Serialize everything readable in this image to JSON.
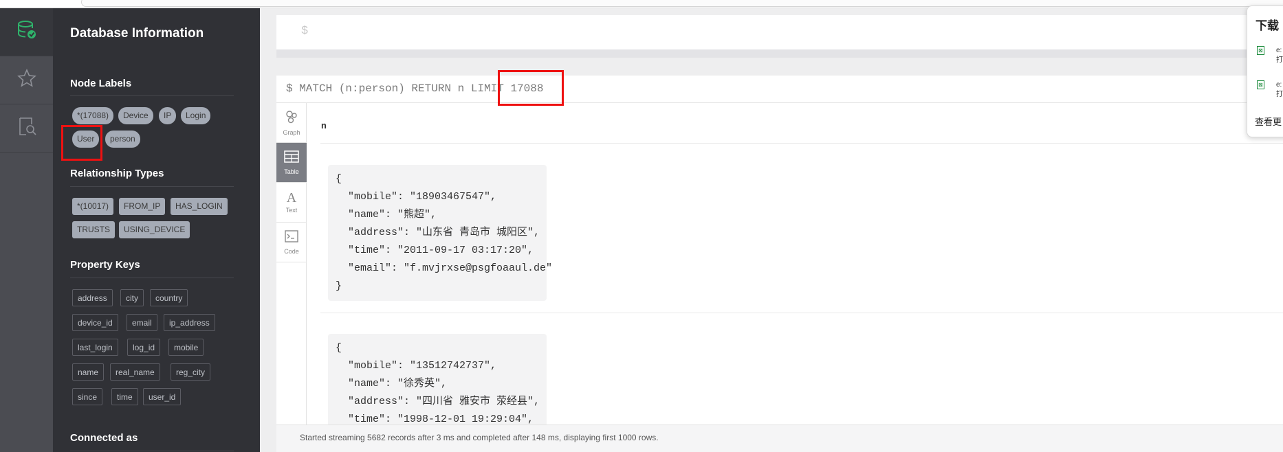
{
  "sidebar": {
    "title": "Database Information",
    "node_labels": {
      "title": "Node Labels",
      "items": [
        "*(17088)",
        "Device",
        "IP",
        "Login",
        "User",
        "person"
      ]
    },
    "relationship_types": {
      "title": "Relationship Types",
      "items": [
        "*(10017)",
        "FROM_IP",
        "HAS_LOGIN",
        "TRUSTS",
        "USING_DEVICE"
      ]
    },
    "property_keys": {
      "title": "Property Keys",
      "items": [
        "address",
        "city",
        "country",
        "device_id",
        "email",
        "ip_address",
        "last_login",
        "log_id",
        "mobile",
        "name",
        "real_name",
        "reg_city",
        "since",
        "time",
        "user_id"
      ]
    },
    "connected_as": "Connected as"
  },
  "rail": {
    "icons": [
      "database-icon",
      "star-icon",
      "search-docs-icon"
    ]
  },
  "editor": {
    "prompt": "$"
  },
  "frame": {
    "query": "$ MATCH (n:person) RETURN n LIMIT 17088",
    "tabs": [
      "Graph",
      "Table",
      "Text",
      "Code"
    ],
    "active_tab": "Table",
    "column_header": "n",
    "records": [
      {
        "open": "{",
        "lines": [
          "\"mobile\": \"18903467547\",",
          "\"name\": \"熊超\",",
          "\"address\": \"山东省 青岛市 城阳区\",",
          "\"time\": \"2011-09-17 03:17:20\",",
          "\"email\": \"f.mvjrxse@psgfoaaul.de\""
        ],
        "close": "}"
      },
      {
        "open": "{",
        "lines": [
          "\"mobile\": \"13512742737\",",
          "\"name\": \"徐秀英\",",
          "\"address\": \"四川省 雅安市 荥经县\",",
          "\"time\": \"1998-12-01 19:29:04\","
        ],
        "close": ""
      }
    ],
    "status": "Started streaming 5682 records after 3 ms and completed after 148 ms, displaying first 1000 rows."
  },
  "download_popup": {
    "title": "下载",
    "files": [
      {
        "name_top": "e:",
        "name_bottom": "打"
      },
      {
        "name_top": "e:",
        "name_bottom": "打"
      }
    ],
    "more": "查看更"
  },
  "colors": {
    "highlight": "#ee1111",
    "sidebar_bg": "#303136",
    "accent": "#2fb36b"
  }
}
